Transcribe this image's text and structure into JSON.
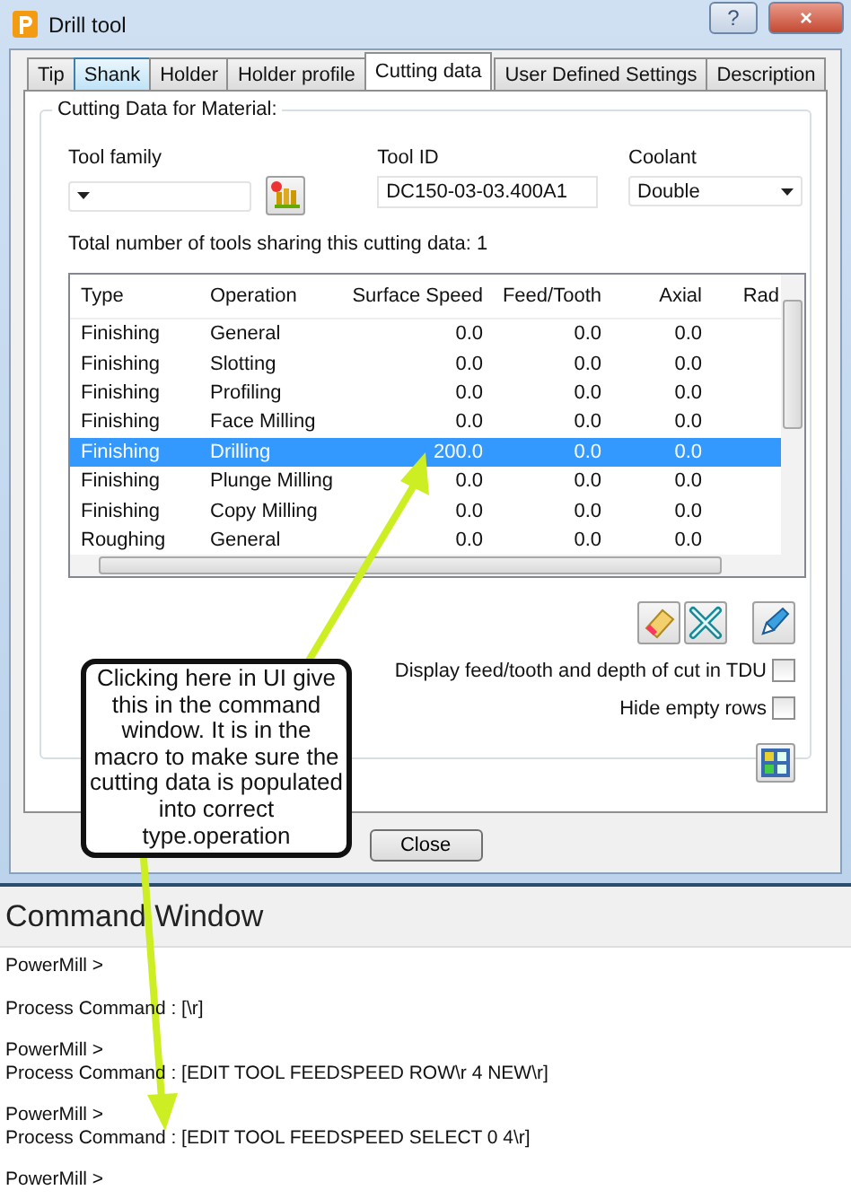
{
  "window": {
    "title": "Drill tool",
    "buttons": [
      {
        "kind": "help",
        "label": "?"
      },
      {
        "kind": "close",
        "label": "×"
      }
    ]
  },
  "tabs": [
    {
      "label": "Tip",
      "selected": false,
      "hovered": false
    },
    {
      "label": "Shank",
      "selected": false,
      "hovered": true
    },
    {
      "label": "Holder",
      "selected": false,
      "hovered": false
    },
    {
      "label": "Holder profile",
      "selected": false,
      "hovered": false
    },
    {
      "label": "Cutting data",
      "selected": true,
      "hovered": false
    },
    {
      "label": "User Defined Settings",
      "selected": false,
      "hovered": false
    },
    {
      "label": "Description",
      "selected": false,
      "hovered": false
    }
  ],
  "group": {
    "title": "Cutting Data for Material:",
    "tool_family": {
      "label": "Tool family"
    },
    "tool_id": {
      "label": "Tool ID",
      "value": "DC150-03-03.400A1"
    },
    "coolant": {
      "label": "Coolant",
      "value": "Double"
    },
    "total": "Total number of tools sharing this cutting data: 1",
    "table": {
      "columns": [
        "Type",
        "Operation",
        "Surface Speed",
        "Feed/Tooth",
        "Axial",
        "Rad"
      ],
      "rows": [
        {
          "cells": [
            "Finishing",
            "General",
            "0.0",
            "0.0",
            "0.0"
          ],
          "selected": false
        },
        {
          "cells": [
            "Finishing",
            "Slotting",
            "0.0",
            "0.0",
            "0.0"
          ],
          "selected": false
        },
        {
          "cells": [
            "Finishing",
            "Profiling",
            "0.0",
            "0.0",
            "0.0"
          ],
          "selected": false
        },
        {
          "cells": [
            "Finishing",
            "Face Milling",
            "0.0",
            "0.0",
            "0.0"
          ],
          "selected": false
        },
        {
          "cells": [
            "Finishing",
            "Drilling",
            "200.0",
            "0.0",
            "0.0"
          ],
          "selected": true
        },
        {
          "cells": [
            "Finishing",
            "Plunge Milling",
            "0.0",
            "0.0",
            "0.0"
          ],
          "selected": false
        },
        {
          "cells": [
            "Finishing",
            "Copy Milling",
            "0.0",
            "0.0",
            "0.0"
          ],
          "selected": false
        },
        {
          "cells": [
            "Roughing",
            "General",
            "0.0",
            "0.0",
            "0.0"
          ],
          "selected": false
        }
      ]
    },
    "checkboxes": [
      {
        "label": "Display feed/tooth and depth of cut in TDU",
        "checked": false
      },
      {
        "label": "Hide empty rows",
        "checked": false
      }
    ]
  },
  "close_button": "Close",
  "command_window": {
    "title": "Command Window",
    "blocks": [
      [
        "PowerMill >"
      ],
      [
        "Process Command : [\\r]"
      ],
      [
        "PowerMill >",
        "Process Command : [EDIT TOOL FEEDSPEED ROW\\r 4 NEW\\r]"
      ],
      [
        "PowerMill >",
        "Process Command : [EDIT TOOL FEEDSPEED SELECT 0 4\\r]"
      ],
      [
        "PowerMill >"
      ]
    ]
  },
  "callout": "Clicking here in UI give this in the command window. It is in the macro to make sure the cutting data is populated into correct type.operation"
}
